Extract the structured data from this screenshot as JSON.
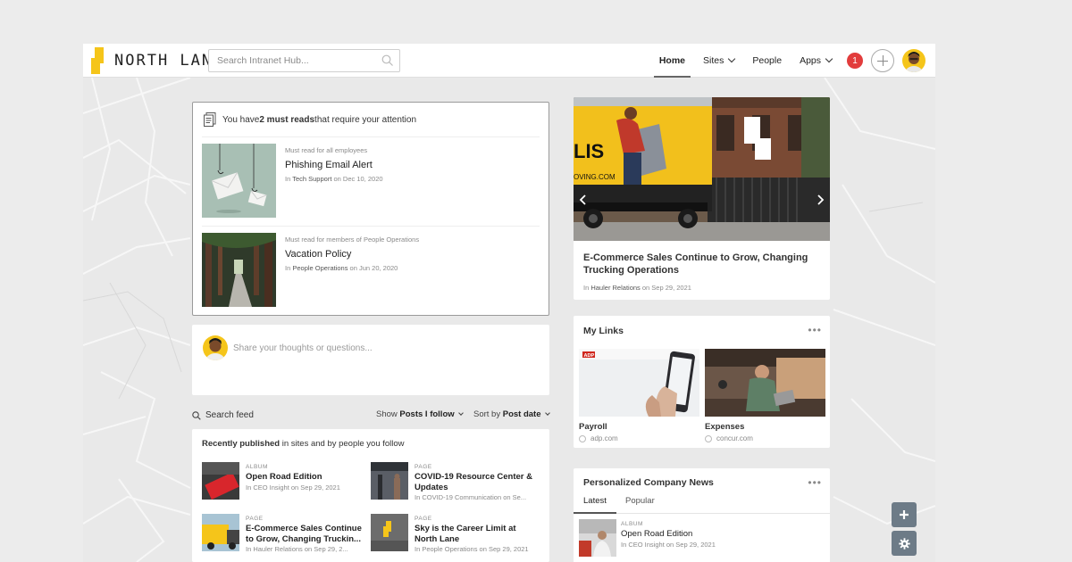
{
  "header": {
    "logo_text": "NORTH LANE",
    "search_placeholder": "Search Intranet Hub...",
    "nav": [
      {
        "label": "Home",
        "active": true
      },
      {
        "label": "Sites",
        "dropdown": true
      },
      {
        "label": "People"
      },
      {
        "label": "Apps",
        "dropdown": true
      }
    ],
    "notification_count": "1",
    "accent_color": "#f5c51a"
  },
  "must_reads": {
    "heading_prefix": "You have ",
    "heading_bold": "2 must reads",
    "heading_suffix": " that require your attention",
    "items": [
      {
        "audience": "Must read for all employees",
        "title": "Phishing Email Alert",
        "meta_in": "In ",
        "site": "Tech Support",
        "meta_on": " on Dec 10, 2020"
      },
      {
        "audience": "Must read for members of People Operations",
        "title": "Vacation Policy",
        "meta_in": "In ",
        "site": "People Operations",
        "meta_on": " on Jun 20, 2020"
      }
    ]
  },
  "composer": {
    "placeholder": "Share your thoughts or questions..."
  },
  "feed": {
    "search_label": "Search feed",
    "show_prefix": "Show ",
    "show_value": "Posts I follow",
    "sort_prefix": "Sort by ",
    "sort_value": "Post date",
    "recent_bold": "Recently published",
    "recent_rest": " in sites and by people you follow",
    "items": [
      {
        "type": "ALBUM",
        "title": "Open Road Edition",
        "meta": "In CEO Insight on Sep 29, 2021"
      },
      {
        "type": "PAGE",
        "title": "COVID-19 Resource Center & Updates",
        "meta": "In COVID-19 Communication on Se..."
      },
      {
        "type": "PAGE",
        "title": "E-Commerce Sales Continue to Grow, Changing Truckin...",
        "meta": "In Hauler Relations on Sep 29, 2..."
      },
      {
        "type": "PAGE",
        "title": "Sky is the Career Limit at North Lane",
        "meta": "In People Operations on Sep 29, 2021"
      }
    ]
  },
  "hero": {
    "title": "E-Commerce Sales Continue to Grow, Changing Trucking Operations",
    "meta_in": "In ",
    "site": "Hauler Relations",
    "meta_on": " on Sep 29, 2021",
    "image_text_lis": "LIS",
    "image_text_url": "OVING.COM"
  },
  "my_links": {
    "title": "My Links",
    "menu": "•••",
    "items": [
      {
        "name": "Payroll",
        "url": "adp.com",
        "badge": "ADP"
      },
      {
        "name": "Expenses",
        "url": "concur.com"
      }
    ]
  },
  "news": {
    "title": "Personalized Company News",
    "menu": "•••",
    "tabs": [
      "Latest",
      "Popular"
    ],
    "item": {
      "type": "ALBUM",
      "title": "Open Road Edition",
      "meta": "In CEO Insight on Sep 29, 2021"
    }
  }
}
